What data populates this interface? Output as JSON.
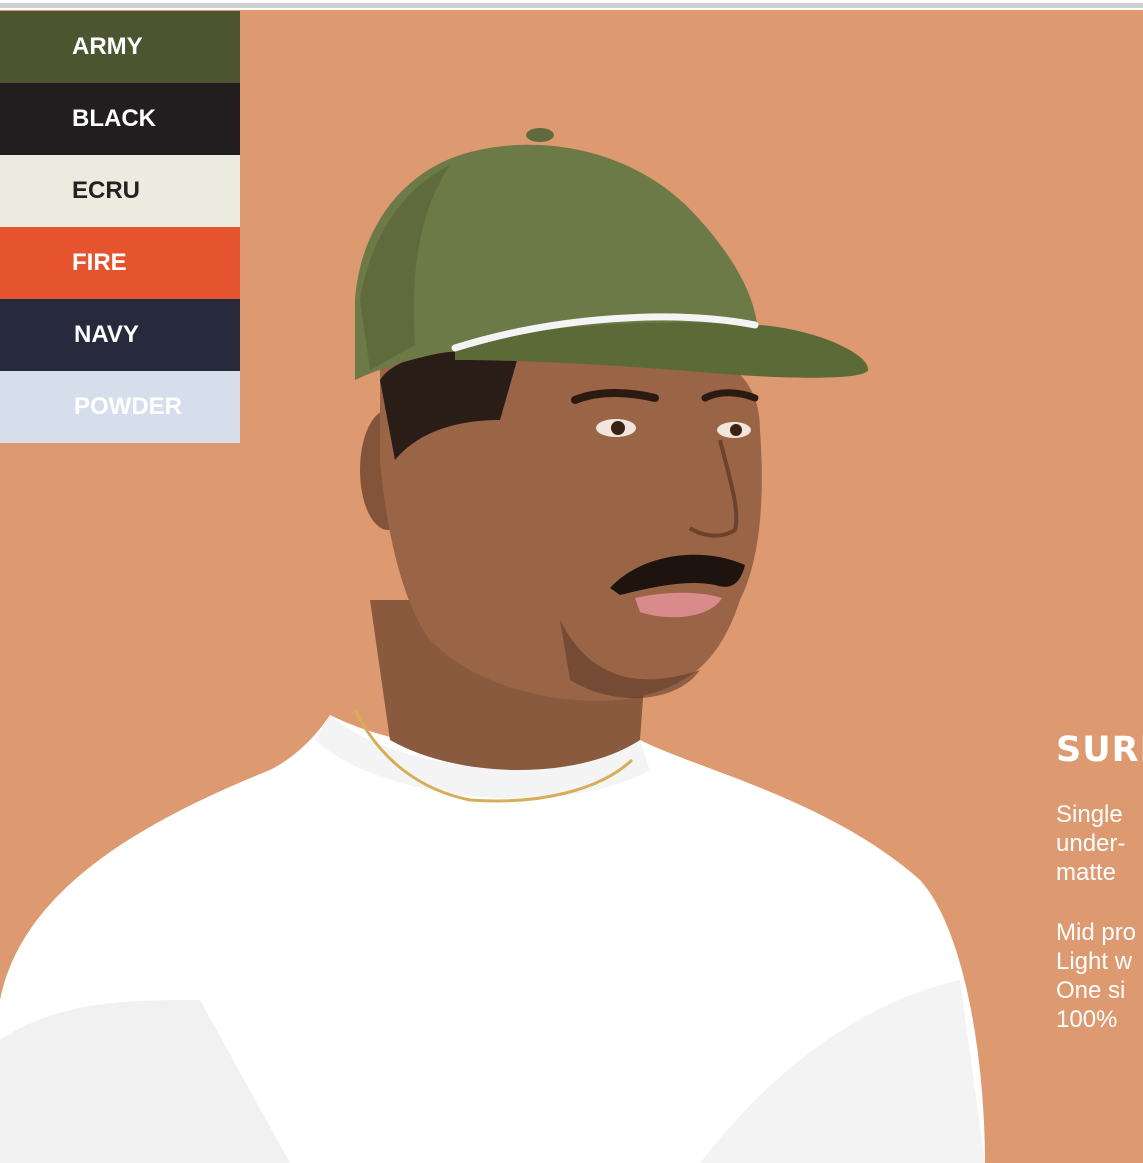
{
  "colors": {
    "background": "#dd9a71",
    "text_light": "#ffffff"
  },
  "swatches": [
    {
      "label": "ARMY",
      "bg": "#4c5530",
      "fg": "#ffffff"
    },
    {
      "label": "BLACK",
      "bg": "#221e1f",
      "fg": "#ffffff"
    },
    {
      "label": "ECRU",
      "bg": "#ecebe0",
      "fg": "#222222"
    },
    {
      "label": "FIRE",
      "bg": "#e5532f",
      "fg": "#ffffff"
    },
    {
      "label": "NAVY",
      "bg": "#272a3c",
      "fg": "#ffffff"
    },
    {
      "label": "POWDER",
      "bg": "#d5deea",
      "fg": "#ffffff"
    }
  ],
  "product": {
    "image": "model-wearing-army-green-cap",
    "title": "SURI",
    "description_lines": [
      "Single",
      "under-",
      "matte"
    ],
    "spec_lines": [
      "Mid pro",
      "Light w",
      "One si",
      "100%"
    ]
  }
}
